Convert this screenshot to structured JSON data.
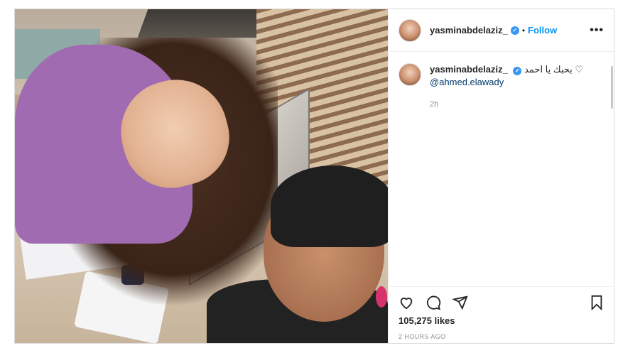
{
  "post": {
    "username": "yasminabdelaziz_",
    "verified_icon": "verified-badge-icon",
    "separator": "•",
    "follow_label": "Follow",
    "more_label": "•••",
    "caption": {
      "username": "yasminabdelaziz_",
      "text": "بحبك يا احمد",
      "emoji": "♡",
      "mention": "@ahmed.elawady",
      "time": "2h"
    },
    "likes": "105,275 likes",
    "timestamp": "2 HOURS AGO",
    "icons": [
      "heart-icon",
      "comment-icon",
      "share-icon",
      "bookmark-icon"
    ],
    "colors": {
      "accent": "#0095f6",
      "verified": "#3897f0",
      "text": "#262626",
      "muted": "#8e8e8e"
    }
  }
}
